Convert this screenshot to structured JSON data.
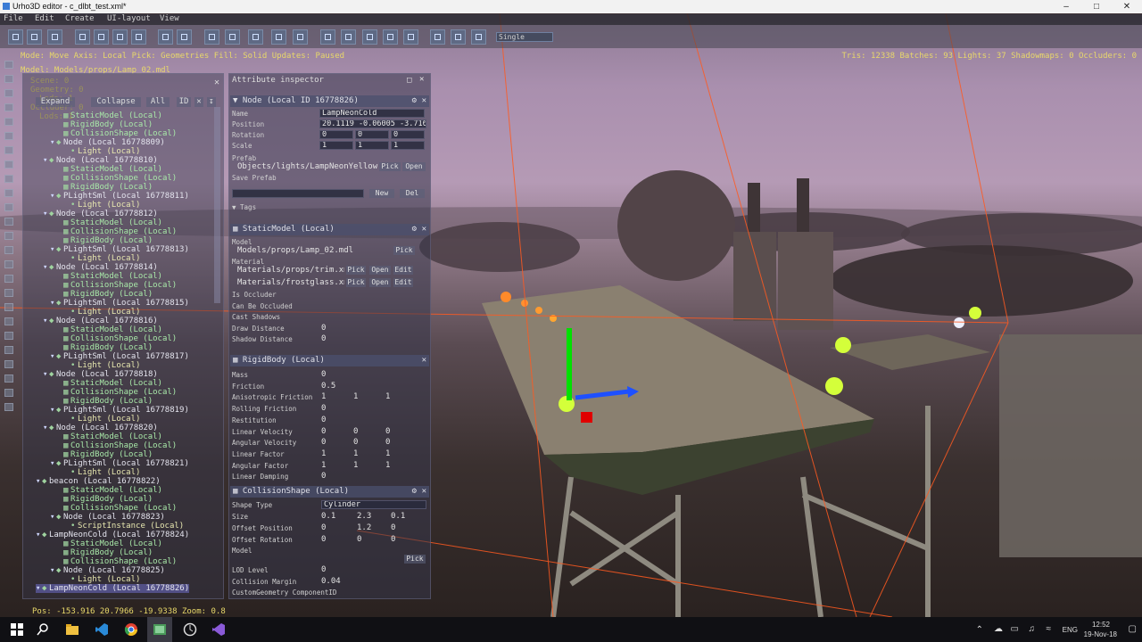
{
  "window": {
    "title": "Urho3D editor - c_dlbt_test.xml*"
  },
  "menu": [
    "File",
    "Edit",
    "Create",
    "UI-layout",
    "View"
  ],
  "toolbar": {
    "select_value": "Single"
  },
  "status": {
    "line": "Mode: Move  Axis: Local  Pick: Geometries  Fill: Solid  Updates: Paused",
    "stats": "Tris: 12338  Batches: 93  Lights: 37  Shadowmaps: 0  Occluders: 0",
    "model": "Model: Models/props/Lamp_02.mdl",
    "overlay": [
      "Scene: 0",
      "Geometry: 0",
      "Lods: 1",
      "Occluder: 0",
      "Lods: 1"
    ],
    "bottom": "Pos: -153.916 20.7966 -19.9338 Zoom: 0.8"
  },
  "hierarchy": {
    "expand": "Expand",
    "collapse": "Collapse",
    "all": "All",
    "id": "ID",
    "rows": [
      {
        "t": "StaticModel (Local)",
        "k": "comp",
        "d": 4
      },
      {
        "t": "RigidBody (Local)",
        "k": "comp",
        "d": 4
      },
      {
        "t": "CollisionShape (Local)",
        "k": "comp",
        "d": 4
      },
      {
        "t": "Node (Local 16778809)",
        "k": "node",
        "d": 3
      },
      {
        "t": "Light (Local)",
        "k": "light",
        "d": 5
      },
      {
        "t": "Node (Local 16778810)",
        "k": "node",
        "d": 2
      },
      {
        "t": "StaticModel (Local)",
        "k": "comp",
        "d": 4
      },
      {
        "t": "CollisionShape (Local)",
        "k": "comp",
        "d": 4
      },
      {
        "t": "RigidBody (Local)",
        "k": "comp",
        "d": 4
      },
      {
        "t": "PLightSml (Local 16778811)",
        "k": "node",
        "d": 3
      },
      {
        "t": "Light (Local)",
        "k": "light",
        "d": 5
      },
      {
        "t": "Node (Local 16778812)",
        "k": "node",
        "d": 2
      },
      {
        "t": "StaticModel (Local)",
        "k": "comp",
        "d": 4
      },
      {
        "t": "CollisionShape (Local)",
        "k": "comp",
        "d": 4
      },
      {
        "t": "RigidBody (Local)",
        "k": "comp",
        "d": 4
      },
      {
        "t": "PLightSml (Local 16778813)",
        "k": "node",
        "d": 3
      },
      {
        "t": "Light (Local)",
        "k": "light",
        "d": 5
      },
      {
        "t": "Node (Local 16778814)",
        "k": "node",
        "d": 2
      },
      {
        "t": "StaticModel (Local)",
        "k": "comp",
        "d": 4
      },
      {
        "t": "CollisionShape (Local)",
        "k": "comp",
        "d": 4
      },
      {
        "t": "RigidBody (Local)",
        "k": "comp",
        "d": 4
      },
      {
        "t": "PLightSml (Local 16778815)",
        "k": "node",
        "d": 3
      },
      {
        "t": "Light (Local)",
        "k": "light",
        "d": 5
      },
      {
        "t": "Node (Local 16778816)",
        "k": "node",
        "d": 2
      },
      {
        "t": "StaticModel (Local)",
        "k": "comp",
        "d": 4
      },
      {
        "t": "CollisionShape (Local)",
        "k": "comp",
        "d": 4
      },
      {
        "t": "RigidBody (Local)",
        "k": "comp",
        "d": 4
      },
      {
        "t": "PLightSml (Local 16778817)",
        "k": "node",
        "d": 3
      },
      {
        "t": "Light (Local)",
        "k": "light",
        "d": 5
      },
      {
        "t": "Node (Local 16778818)",
        "k": "node",
        "d": 2
      },
      {
        "t": "StaticModel (Local)",
        "k": "comp",
        "d": 4
      },
      {
        "t": "CollisionShape (Local)",
        "k": "comp",
        "d": 4
      },
      {
        "t": "RigidBody (Local)",
        "k": "comp",
        "d": 4
      },
      {
        "t": "PLightSml (Local 16778819)",
        "k": "node",
        "d": 3
      },
      {
        "t": "Light (Local)",
        "k": "light",
        "d": 5
      },
      {
        "t": "Node (Local 16778820)",
        "k": "node",
        "d": 2
      },
      {
        "t": "StaticModel (Local)",
        "k": "comp",
        "d": 4
      },
      {
        "t": "CollisionShape (Local)",
        "k": "comp",
        "d": 4
      },
      {
        "t": "RigidBody (Local)",
        "k": "comp",
        "d": 4
      },
      {
        "t": "PLightSml (Local 16778821)",
        "k": "node",
        "d": 3
      },
      {
        "t": "Light (Local)",
        "k": "light",
        "d": 5
      },
      {
        "t": "beacon (Local 16778822)",
        "k": "node",
        "d": 1
      },
      {
        "t": "StaticModel (Local)",
        "k": "comp",
        "d": 4
      },
      {
        "t": "RigidBody (Local)",
        "k": "comp",
        "d": 4
      },
      {
        "t": "CollisionShape (Local)",
        "k": "comp",
        "d": 4
      },
      {
        "t": "Node (Local 16778823)",
        "k": "node",
        "d": 3
      },
      {
        "t": "ScriptInstance (Local)",
        "k": "light",
        "d": 5
      },
      {
        "t": "LampNeonCold (Local 16778824)",
        "k": "node",
        "d": 1
      },
      {
        "t": "StaticModel (Local)",
        "k": "comp",
        "d": 4
      },
      {
        "t": "RigidBody (Local)",
        "k": "comp",
        "d": 4
      },
      {
        "t": "CollisionShape (Local)",
        "k": "comp",
        "d": 4
      },
      {
        "t": "Node (Local 16778825)",
        "k": "node",
        "d": 3
      },
      {
        "t": "Light (Local)",
        "k": "light",
        "d": 5
      },
      {
        "t": "LampNeonCold (Local 16778826)",
        "k": "node",
        "d": 1,
        "selected": true
      }
    ]
  },
  "inspector": {
    "title": "Attribute inspector",
    "node": {
      "header": "Node (Local ID 16778826)",
      "name_label": "Name",
      "name": "LampNeonCold",
      "position_label": "Position",
      "position": "20.1119 -0.06005 -3.7160",
      "rotation_label": "Rotation",
      "rotation": [
        "0",
        "0",
        "0"
      ],
      "scale_label": "Scale",
      "scale": [
        "1",
        "1",
        "1"
      ],
      "prefab_label": "Prefab",
      "prefab": "Objects/lights/LampNeonYellow",
      "pick": "Pick",
      "open": "Open",
      "save_prefab": "Save Prefab",
      "new": "New",
      "del": "Del",
      "tags": "Tags"
    },
    "staticmodel": {
      "header": "StaticModel (Local)",
      "model_label": "Model",
      "model": "Models/props/Lamp_02.mdl",
      "pick": "Pick",
      "material_label": "Material",
      "materials": [
        "Materials/props/trim.xml",
        "Materials/frostglass.xml"
      ],
      "open": "Open",
      "edit": "Edit",
      "rows": [
        {
          "l": "Is Occluder",
          "v": ""
        },
        {
          "l": "Can Be Occluded",
          "v": ""
        },
        {
          "l": "Cast Shadows",
          "v": ""
        },
        {
          "l": "Draw Distance",
          "v": "0"
        },
        {
          "l": "Shadow Distance",
          "v": "0"
        }
      ]
    },
    "rigidbody": {
      "header": "RigidBody (Local)",
      "rows": [
        {
          "l": "Mass",
          "v": [
            "0"
          ]
        },
        {
          "l": "Friction",
          "v": [
            "0.5"
          ]
        },
        {
          "l": "Anisotropic Friction",
          "v": [
            "1",
            "1",
            "1"
          ]
        },
        {
          "l": "Rolling Friction",
          "v": [
            "0"
          ]
        },
        {
          "l": "Restitution",
          "v": [
            "0"
          ]
        },
        {
          "l": "Linear Velocity",
          "v": [
            "0",
            "0",
            "0"
          ]
        },
        {
          "l": "Angular Velocity",
          "v": [
            "0",
            "0",
            "0"
          ]
        },
        {
          "l": "Linear Factor",
          "v": [
            "1",
            "1",
            "1"
          ]
        },
        {
          "l": "Angular Factor",
          "v": [
            "1",
            "1",
            "1"
          ]
        },
        {
          "l": "Linear Damping",
          "v": [
            "0"
          ]
        }
      ]
    },
    "collision": {
      "header": "CollisionShape (Local)",
      "shape_label": "Shape Type",
      "shape": "Cylinder",
      "size_label": "Size",
      "size": [
        "0.1",
        "2.3",
        "0.1"
      ],
      "offset_pos_label": "Offset Position",
      "offset_pos": [
        "0",
        "1.2",
        "0"
      ],
      "offset_rot_label": "Offset Rotation",
      "offset_rot": [
        "0",
        "0",
        "0"
      ],
      "model_label": "Model",
      "pick": "Pick",
      "lod_label": "LOD Level",
      "lod": "0",
      "margin_label": "Collision Margin",
      "margin": "0.04",
      "custom_label": "CustomGeometry ComponentID"
    }
  },
  "taskbar": {
    "lang": "ENG",
    "time": "12:52",
    "date": "19-Nov-18"
  },
  "colors": {
    "gizmo_x": "#1e50ff",
    "gizmo_y": "#00e000",
    "gizmo_z": "#e00000",
    "lamp": "#d4ff3a",
    "status": "#e8d86a"
  }
}
